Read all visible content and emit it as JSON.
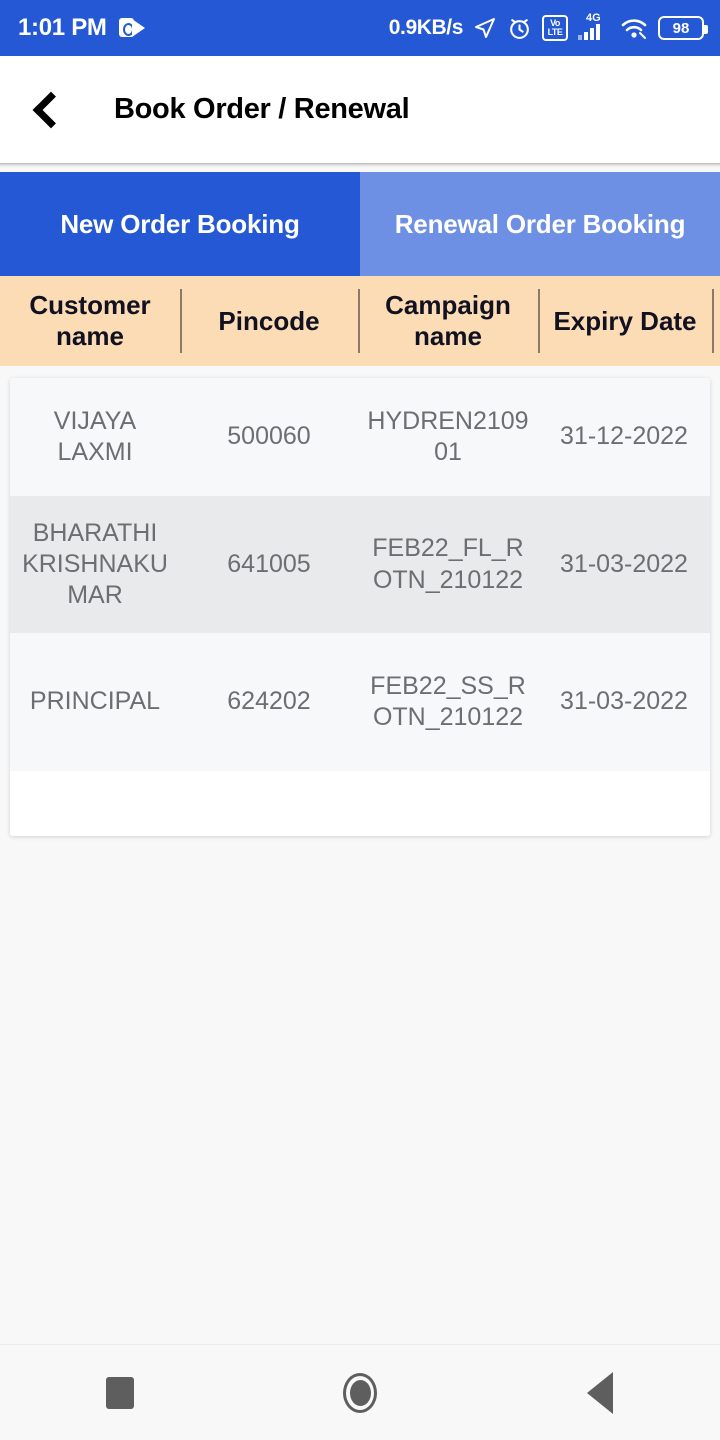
{
  "status_bar": {
    "time": "1:01 PM",
    "notification_icon": "outlook-icon",
    "network_speed": "0.9KB/s",
    "icons": [
      "location-arrow-icon",
      "alarm-clock-icon",
      "volte-icon",
      "signal-4g-icon",
      "wifi-icon",
      "battery-icon"
    ],
    "volte_top": "Vo",
    "volte_bottom": "LTE",
    "network_type": "4G",
    "battery_level": "98",
    "background_color": "#2458d4"
  },
  "app_bar": {
    "back_label": "back-chevron",
    "title": "Book Order / Renewal"
  },
  "tabs": [
    {
      "label": "New Order Booking",
      "active": true,
      "color": "#2458d4"
    },
    {
      "label": "Renewal Order Booking",
      "active": false,
      "color": "#6d8fe4"
    }
  ],
  "table": {
    "header_background": "#fbdcb4",
    "columns": [
      "Customer name",
      "Pincode",
      "Campaign name",
      "Expiry Date"
    ],
    "rows": [
      {
        "customer_name": "VIJAYA LAXMI",
        "pincode": "500060",
        "campaign_name": "HYDREN210901",
        "expiry_date": "31-12-2022"
      },
      {
        "customer_name": "BHARATHI KRISHNAKUMAR",
        "pincode": "641005",
        "campaign_name": "FEB22_FL_ROTN_210122",
        "expiry_date": "31-03-2022"
      },
      {
        "customer_name": "PRINCIPAL",
        "pincode": "624202",
        "campaign_name": "FEB22_SS_ROTN_210122",
        "expiry_date": "31-03-2022"
      }
    ]
  },
  "nav_bar": {
    "recents": "recents-square",
    "home": "home-circle",
    "back": "back-triangle"
  }
}
